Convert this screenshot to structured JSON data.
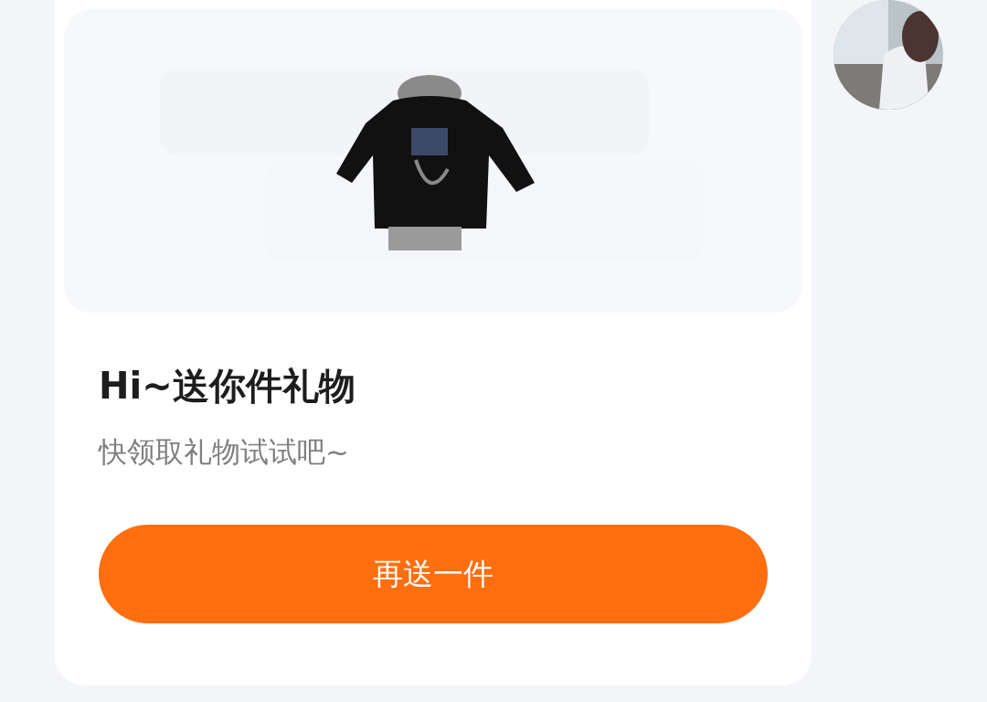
{
  "gift_card": {
    "title": "Hi~送你件礼物",
    "subtitle": "快领取礼物试试吧~",
    "button": "再送一件"
  }
}
